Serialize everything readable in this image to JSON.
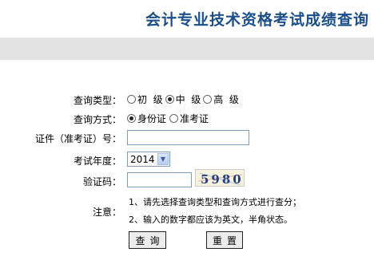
{
  "header": {
    "title": "会计专业技术资格考试成绩查询"
  },
  "form": {
    "query_type": {
      "label": "查询类型：",
      "options": [
        {
          "label": "初  级",
          "checked": false
        },
        {
          "label": "中  级",
          "checked": true
        },
        {
          "label": "高  级",
          "checked": false
        }
      ]
    },
    "query_method": {
      "label": "查询方式：",
      "options": [
        {
          "label": "身份证",
          "checked": true
        },
        {
          "label": "准考证",
          "checked": false
        }
      ]
    },
    "id_number": {
      "label": "证件（准考证）号：",
      "value": ""
    },
    "exam_year": {
      "label": "考试年度：",
      "value": "2014"
    },
    "captcha": {
      "label": "验证码：",
      "value": "",
      "image_text": "5980"
    },
    "notes": {
      "label": "注意：",
      "lines": [
        "1、请先选择查询类型和查询方式进行查分；",
        "2、输入的数字都应该为英文，半角状态。"
      ]
    },
    "buttons": {
      "query": "查询",
      "reset": "重置"
    }
  },
  "colors": {
    "title": "#1b4f8a",
    "band": "#e3e3e3"
  }
}
